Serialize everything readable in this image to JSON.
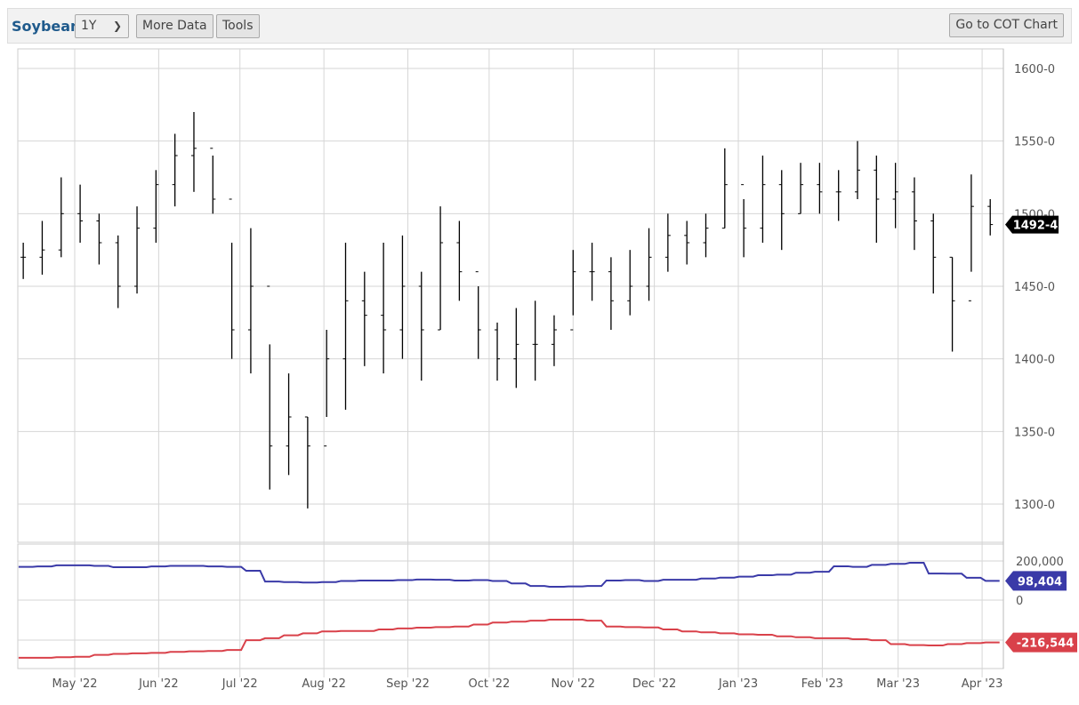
{
  "toolbar": {
    "title": "Soybean",
    "range": "1Y",
    "more_data": "More Data",
    "tools": "Tools",
    "cot": "Go to COT Chart"
  },
  "colors": {
    "series1": "#3a3aa8",
    "series2": "#d9414a",
    "price": "#000000",
    "grid": "#d6d6d6"
  },
  "chart_data": [
    {
      "type": "ohlc",
      "price_axis": {
        "ticks": [
          1300,
          1350,
          1400,
          1450,
          1500,
          1550,
          1600
        ],
        "tick_labels": [
          "1300-0",
          "1350-0",
          "1400-0",
          "1450-0",
          "1500-0",
          "1550-0",
          "1600-0"
        ],
        "ylim": [
          1290,
          1607
        ]
      },
      "x_ticks": [
        "May '22",
        "Jun '22",
        "Jul '22",
        "Aug '22",
        "Sep '22",
        "Oct '22",
        "Nov '22",
        "Dec '22",
        "Jan '23",
        "Feb '23",
        "Mar '23",
        "Apr '23"
      ],
      "x_tick_dates": [
        "2022-05-01",
        "2022-06-01",
        "2022-07-01",
        "2022-08-01",
        "2022-09-01",
        "2022-10-01",
        "2022-11-01",
        "2022-12-01",
        "2023-01-01",
        "2023-02-01",
        "2023-03-01",
        "2023-04-01"
      ],
      "last_label": "1492-4",
      "last_value": 1492.5,
      "dates": [
        "2022-04-12",
        "2022-04-19",
        "2022-04-26",
        "2022-05-03",
        "2022-05-10",
        "2022-05-17",
        "2022-05-24",
        "2022-05-31",
        "2022-06-07",
        "2022-06-14",
        "2022-06-21",
        "2022-06-28",
        "2022-07-05",
        "2022-07-12",
        "2022-07-19",
        "2022-07-26",
        "2022-08-02",
        "2022-08-09",
        "2022-08-16",
        "2022-08-23",
        "2022-08-30",
        "2022-09-06",
        "2022-09-13",
        "2022-09-20",
        "2022-09-27",
        "2022-10-04",
        "2022-10-11",
        "2022-10-18",
        "2022-10-25",
        "2022-11-01",
        "2022-11-08",
        "2022-11-15",
        "2022-11-22",
        "2022-11-29",
        "2022-12-06",
        "2022-12-13",
        "2022-12-20",
        "2022-12-27",
        "2023-01-03",
        "2023-01-10",
        "2023-01-17",
        "2023-01-24",
        "2023-01-31",
        "2023-02-07",
        "2023-02-14",
        "2023-02-21",
        "2023-02-28",
        "2023-03-07",
        "2023-03-14",
        "2023-03-21",
        "2023-03-28",
        "2023-04-04"
      ],
      "high": [
        1480,
        1495,
        1525,
        1520,
        1500,
        1485,
        1505,
        1530,
        1555,
        1570,
        1540,
        1480,
        1490,
        1410,
        1390,
        1360,
        1420,
        1480,
        1460,
        1480,
        1485,
        1460,
        1505,
        1495,
        1450,
        1425,
        1435,
        1440,
        1430,
        1475,
        1480,
        1470,
        1475,
        1490,
        1500,
        1495,
        1500,
        1545,
        1510,
        1540,
        1530,
        1535,
        1535,
        1530,
        1550,
        1540,
        1535,
        1525,
        1500,
        1470,
        1527,
        1510
      ],
      "low": [
        1455,
        1458,
        1470,
        1480,
        1465,
        1435,
        1445,
        1480,
        1505,
        1515,
        1500,
        1400,
        1390,
        1310,
        1320,
        1297,
        1360,
        1365,
        1395,
        1390,
        1400,
        1385,
        1420,
        1440,
        1400,
        1385,
        1380,
        1385,
        1395,
        1430,
        1440,
        1420,
        1430,
        1440,
        1460,
        1465,
        1470,
        1490,
        1470,
        1480,
        1475,
        1500,
        1500,
        1495,
        1510,
        1480,
        1490,
        1475,
        1445,
        1405,
        1460,
        1485
      ],
      "close": [
        1470,
        1475,
        1500,
        1495,
        1480,
        1450,
        1490,
        1520,
        1540,
        1545,
        1510,
        1420,
        1450,
        1340,
        1360,
        1340,
        1400,
        1440,
        1430,
        1420,
        1450,
        1420,
        1480,
        1460,
        1420,
        1400,
        1410,
        1410,
        1420,
        1460,
        1460,
        1440,
        1450,
        1470,
        1485,
        1480,
        1490,
        1520,
        1490,
        1520,
        1500,
        1520,
        1515,
        1515,
        1530,
        1510,
        1515,
        1495,
        1470,
        1440,
        1505,
        1492.5
      ]
    },
    {
      "type": "step",
      "y_ticks": [
        200000,
        0
      ],
      "y_tick_labels": [
        "200,000",
        "0"
      ],
      "ylim": [
        -320000,
        280000
      ],
      "series": [
        {
          "color": "#3a3aa8",
          "last_label": "98,404",
          "values": [
            170000,
            172000,
            178000,
            178000,
            175000,
            168000,
            168000,
            172000,
            175000,
            175000,
            172000,
            170000,
            150000,
            95000,
            92000,
            90000,
            92000,
            98000,
            100000,
            100000,
            102000,
            105000,
            104000,
            100000,
            102000,
            98000,
            85000,
            72000,
            68000,
            70000,
            72000,
            100000,
            102000,
            98000,
            104000,
            104000,
            110000,
            115000,
            120000,
            127000,
            130000,
            140000,
            145000,
            173000,
            170000,
            180000,
            185000,
            191000,
            136000,
            135000,
            114000,
            98404
          ]
        },
        {
          "color": "#d9414a",
          "last_label": "-216,544",
          "values": [
            -295000,
            -295000,
            -292000,
            -290000,
            -280000,
            -275000,
            -272000,
            -270000,
            -265000,
            -262000,
            -260000,
            -255000,
            -205000,
            -195000,
            -180000,
            -170000,
            -160000,
            -158000,
            -158000,
            -150000,
            -145000,
            -141000,
            -138000,
            -135000,
            -125000,
            -115000,
            -110000,
            -105000,
            -100000,
            -100000,
            -105000,
            -135000,
            -138000,
            -140000,
            -150000,
            -160000,
            -165000,
            -170000,
            -175000,
            -177000,
            -185000,
            -190000,
            -195000,
            -195000,
            -200000,
            -205000,
            -225000,
            -230000,
            -232000,
            -225000,
            -220000,
            -216544
          ]
        }
      ]
    }
  ]
}
